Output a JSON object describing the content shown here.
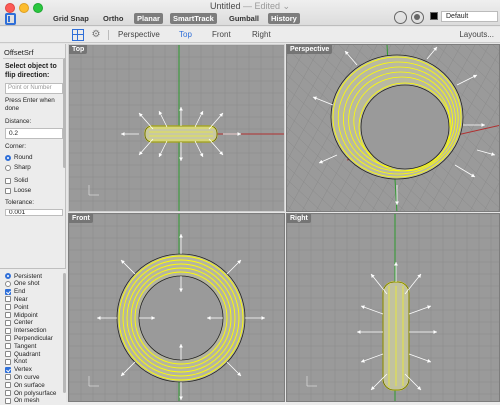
{
  "window": {
    "title": "Untitled",
    "edited": "— Edited ⌄"
  },
  "toolbar": {
    "items": [
      "Grid Snap",
      "Ortho",
      "Planar",
      "SmartTrack",
      "Gumball",
      "History"
    ],
    "active": [
      false,
      false,
      true,
      true,
      false,
      true
    ],
    "layer": "Default"
  },
  "tabs": {
    "views": [
      "Perspective",
      "Top",
      "Front",
      "Right"
    ],
    "active": "Top",
    "layouts": "Layouts..."
  },
  "panel": {
    "command": "OffsetSrf",
    "prompt": "Select object to flip direction:",
    "input_placeholder": "Point or Number",
    "hint": "Press Enter when done",
    "distance_label": "Distance:",
    "distance_value": "0.2",
    "corner_label": "Corner:",
    "corner_options": [
      "Round",
      "Sharp"
    ],
    "corner_selected": "Round",
    "solid_label": "Solid",
    "loose_label": "Loose",
    "tolerance_label": "Tolerance:",
    "tolerance_value": "0.001"
  },
  "osnap": {
    "modes": [
      {
        "label": "Persistent",
        "type": "radio",
        "on": true
      },
      {
        "label": "One shot",
        "type": "radio",
        "on": false
      },
      {
        "label": "End",
        "type": "check",
        "on": true
      },
      {
        "label": "Near",
        "type": "check",
        "on": false
      },
      {
        "label": "Point",
        "type": "check",
        "on": false
      },
      {
        "label": "Midpoint",
        "type": "check",
        "on": false
      },
      {
        "label": "Center",
        "type": "check",
        "on": false
      },
      {
        "label": "Intersection",
        "type": "check",
        "on": false
      },
      {
        "label": "Perpendicular",
        "type": "check",
        "on": false
      },
      {
        "label": "Tangent",
        "type": "check",
        "on": false
      },
      {
        "label": "Quadrant",
        "type": "check",
        "on": false
      },
      {
        "label": "Knot",
        "type": "check",
        "on": false
      },
      {
        "label": "Vertex",
        "type": "check",
        "on": true
      },
      {
        "label": "On curve",
        "type": "check",
        "on": false
      },
      {
        "label": "On surface",
        "type": "check",
        "on": false
      },
      {
        "label": "On polysurface",
        "type": "check",
        "on": false
      },
      {
        "label": "On mesh",
        "type": "check",
        "on": false
      }
    ]
  },
  "viewports": {
    "top": "Top",
    "perspective": "Perspective",
    "front": "Front",
    "right": "Right"
  },
  "colors": {
    "accent": "#2f6fd8",
    "viewport_bg": "#9a9a9a",
    "selection": "#ffff00",
    "x_axis": "#b03030",
    "y_axis": "#2f9a2f"
  }
}
